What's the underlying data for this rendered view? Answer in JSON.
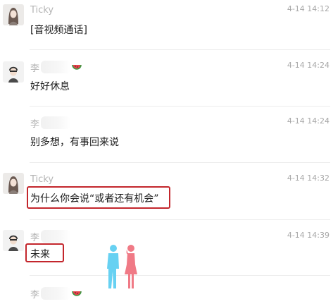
{
  "messages": [
    {
      "sender": "Ticky",
      "time": "4-14 14:12",
      "text": "[音视频通话]",
      "avatar": "ticky-avatar",
      "highlighted": false
    },
    {
      "sender": "李",
      "time": "4-14 14:24",
      "text": "好好休息",
      "avatar": "li-avatar",
      "highlighted": false
    },
    {
      "sender": "李",
      "time": "4-14 14:24",
      "text": "别多想，有事回来说",
      "avatar": "li-avatar",
      "highlighted": false
    },
    {
      "sender": "Ticky",
      "time": "4-14 14:32",
      "text": "为什么你会说“或者还有机会”",
      "avatar": "ticky-avatar",
      "highlighted": true
    },
    {
      "sender": "李",
      "time": "4-14 14:39",
      "text": "未来",
      "avatar": "li-avatar",
      "highlighted": true
    },
    {
      "sender": "李",
      "time": "",
      "text": "",
      "avatar": "li-avatar",
      "highlighted": false
    }
  ],
  "icons": [
    "watermelon-emoji-icon",
    "couple-silhouette-watermark-icon"
  ],
  "colors": {
    "highlight_border": "#c3262c",
    "time_text": "#a7a7a7",
    "name_text": "#b4b4b4",
    "couple_man": "#67d1f2",
    "couple_woman": "#f07a86"
  }
}
